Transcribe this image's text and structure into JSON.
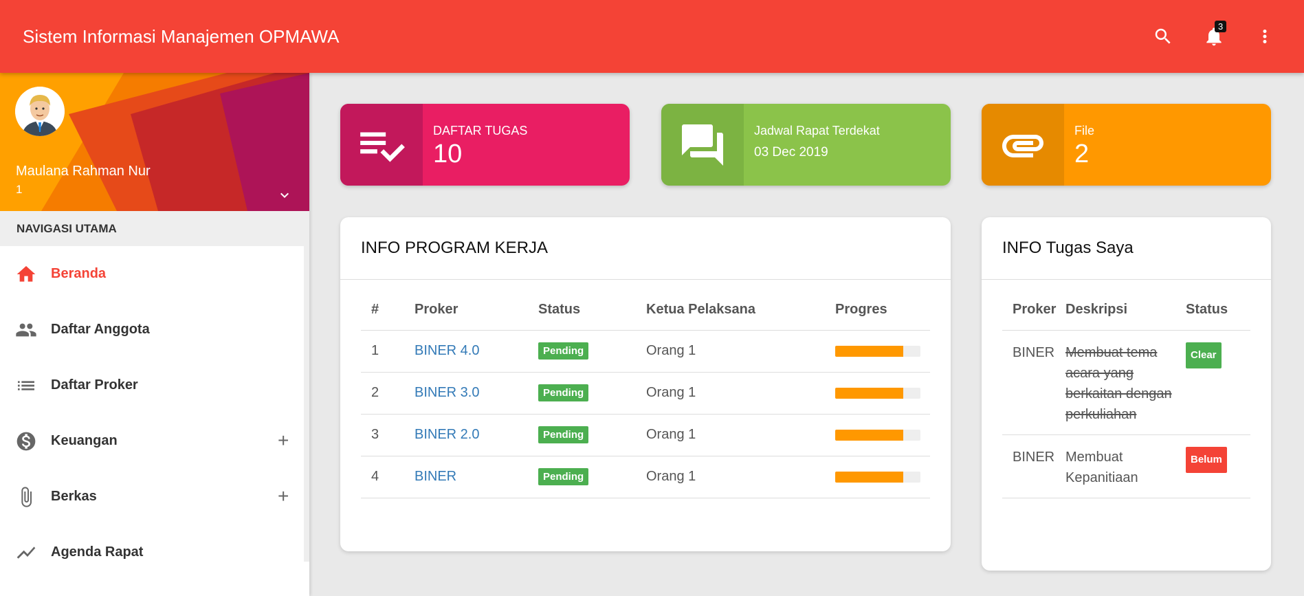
{
  "app": {
    "title": "Sistem Informasi Manajemen OPMAWA",
    "notification_count": "3"
  },
  "topbar_icons": [
    "search-icon",
    "bell-icon",
    "more-vert-icon"
  ],
  "user": {
    "name": "Maulana Rahman Nur",
    "sub": "1"
  },
  "nav": {
    "header": "NAVIGASI UTAMA",
    "items": [
      {
        "label": "Beranda",
        "icon": "home-icon"
      },
      {
        "label": "Daftar Anggota",
        "icon": "people-icon"
      },
      {
        "label": "Daftar Proker",
        "icon": "list-icon"
      },
      {
        "label": "Keuangan",
        "icon": "dollar-icon",
        "expand": "+"
      },
      {
        "label": "Berkas",
        "icon": "paperclip-icon",
        "expand": "+"
      },
      {
        "label": "Agenda Rapat",
        "icon": "trending-icon"
      }
    ]
  },
  "info_boxes": {
    "tasks": {
      "label": "DAFTAR TUGAS",
      "value": "10",
      "color": "#e91e63"
    },
    "meeting": {
      "label": "Jadwal Rapat Terdekat",
      "value": "03 Dec 2019",
      "color": "#8bc34a"
    },
    "files": {
      "label": "File",
      "value": "2",
      "color": "#ff9800"
    }
  },
  "program_card": {
    "title": "INFO PROGRAM KERJA",
    "columns": [
      "#",
      "Proker",
      "Status",
      "Ketua Pelaksana",
      "Progres"
    ],
    "rows": [
      {
        "no": "1",
        "proker": "BINER 4.0",
        "status": "Pending",
        "ketua": "Orang 1",
        "progress": 0.8
      },
      {
        "no": "2",
        "proker": "BINER 3.0",
        "status": "Pending",
        "ketua": "Orang 1",
        "progress": 0.8
      },
      {
        "no": "3",
        "proker": "BINER 2.0",
        "status": "Pending",
        "ketua": "Orang 1",
        "progress": 0.8
      },
      {
        "no": "4",
        "proker": "BINER",
        "status": "Pending",
        "ketua": "Orang 1",
        "progress": 0.8
      }
    ]
  },
  "task_card": {
    "title": "INFO Tugas Saya",
    "columns": [
      "Proker",
      "Deskripsi",
      "Status"
    ],
    "rows": [
      {
        "proker": "BINER",
        "deskripsi": "Membuat tema acara yang berkaitan dengan perkuliahan",
        "status": "Clear",
        "done": true
      },
      {
        "proker": "BINER",
        "deskripsi": "Membuat Kepanitiaan",
        "status": "Belum",
        "done": false
      }
    ]
  }
}
